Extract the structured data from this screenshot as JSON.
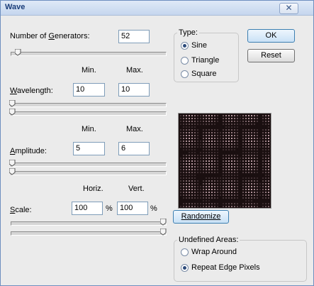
{
  "window": {
    "title": "Wave",
    "close_glyph": "✕"
  },
  "generators": {
    "label": "Number of Generators:",
    "value": "52",
    "slider_fraction": 0.05
  },
  "headers_minmax": {
    "min": "Min.",
    "max": "Max."
  },
  "wavelength": {
    "label": "Wavelength:",
    "min": "10",
    "max": "10",
    "min_slider_fraction": 0.0,
    "max_slider_fraction": 0.0
  },
  "amplitude": {
    "label": "Amplitude:",
    "min": "5",
    "max": "6",
    "min_slider_fraction": 0.0,
    "max_slider_fraction": 0.0
  },
  "headers_scale": {
    "horiz": "Horiz.",
    "vert": "Vert."
  },
  "scale": {
    "label": "Scale:",
    "horiz": "100",
    "vert": "100",
    "percent": "%",
    "horiz_slider_fraction": 1.0,
    "vert_slider_fraction": 1.0
  },
  "type_group": {
    "title": "Type:",
    "options": [
      "Sine",
      "Triangle",
      "Square"
    ],
    "selected": "Sine"
  },
  "buttons": {
    "ok": "OK",
    "reset": "Reset",
    "randomize": "Randomize"
  },
  "undefined_group": {
    "title": "Undefined Areas:",
    "options": [
      "Wrap Around",
      "Repeat Edge Pixels"
    ],
    "selected": "Repeat Edge Pixels"
  },
  "colors": {
    "preview_bg": "#1a0f10",
    "preview_dot": "#c9a9b0"
  }
}
